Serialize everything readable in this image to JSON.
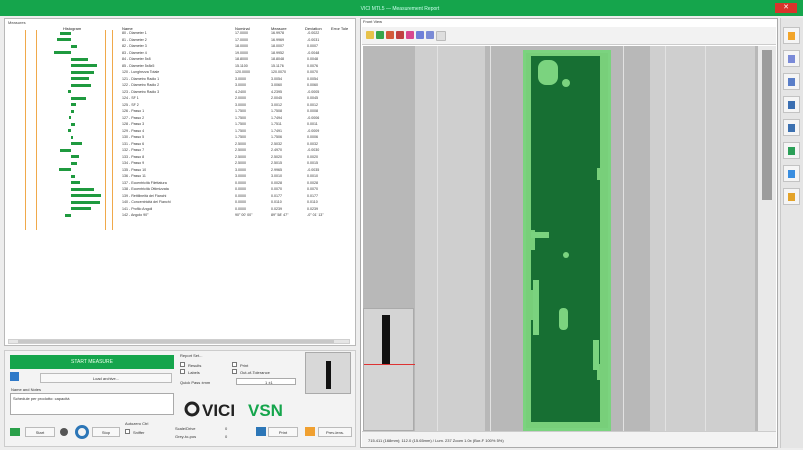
{
  "window": {
    "title": "VICI MTL5 — Measurement Report",
    "close_label": "✕"
  },
  "left_panel": {
    "title": "Measures",
    "headers": {
      "histogram": "Histogram",
      "name": "Name",
      "nominal": "Nominal",
      "measure": "Measure",
      "deviation": "Deviation",
      "error": "Error Tole"
    },
    "rows": [
      {
        "name": "80 - Diameter 1",
        "nom": "17.0000",
        "meas": "16.9978",
        "dev": "-0.0022"
      },
      {
        "name": "81 - Diameter 2",
        "nom": "17.0000",
        "meas": "16.9969",
        "dev": "-0.0031"
      },
      {
        "name": "82 - Diameter 3",
        "nom": "18.0000",
        "meas": "18.0007",
        "dev": "0.0007"
      },
      {
        "name": "83 - Diameter 4",
        "nom": "19.0000",
        "meas": "18.9952",
        "dev": "-0.0048"
      },
      {
        "name": "84 - Diameter 5x8",
        "nom": "18.8000",
        "meas": "18.8048",
        "dev": "0.0048"
      },
      {
        "name": "85 - Diameter 5x8x5",
        "nom": "15.1100",
        "meas": "15.1176",
        "dev": "0.0076"
      },
      {
        "name": "120 - Lunghezza Totale",
        "nom": "120.0000",
        "meas": "120.0070",
        "dev": "0.0070"
      },
      {
        "name": "121 - Diametro Radio 1",
        "nom": "3.0000",
        "meas": "3.0054",
        "dev": "0.0054"
      },
      {
        "name": "122 - Diametro Radio 2",
        "nom": "3.0000",
        "meas": "3.0060",
        "dev": "0.0060"
      },
      {
        "name": "123 - Diametro Radio 3",
        "nom": "4.2400",
        "meas": "4.2395",
        "dev": "-0.0005"
      },
      {
        "name": "124 - SF 1",
        "nom": "2.0000",
        "meas": "2.0045",
        "dev": "0.0045"
      },
      {
        "name": "125 - SF 2",
        "nom": "3.0000",
        "meas": "3.0012",
        "dev": "0.0012"
      },
      {
        "name": "126 - Passo 1",
        "nom": "1.7500",
        "meas": "1.7508",
        "dev": "0.0008"
      },
      {
        "name": "127 - Passo 2",
        "nom": "1.7500",
        "meas": "1.7494",
        "dev": "-0.0006"
      },
      {
        "name": "128 - Passo 3",
        "nom": "1.7500",
        "meas": "1.7511",
        "dev": "0.0011"
      },
      {
        "name": "129 - Passo 4",
        "nom": "1.7500",
        "meas": "1.7491",
        "dev": "-0.0009"
      },
      {
        "name": "130 - Passo 5",
        "nom": "1.7500",
        "meas": "1.7506",
        "dev": "0.0006"
      },
      {
        "name": "131 - Passo 6",
        "nom": "2.5000",
        "meas": "2.5032",
        "dev": "0.0032"
      },
      {
        "name": "132 - Passo 7",
        "nom": "2.5000",
        "meas": "2.4970",
        "dev": "-0.0030"
      },
      {
        "name": "133 - Passo 8",
        "nom": "2.5000",
        "meas": "2.5020",
        "dev": "0.0020"
      },
      {
        "name": "134 - Passo 9",
        "nom": "2.5000",
        "meas": "2.5015",
        "dev": "0.0015"
      },
      {
        "name": "135 - Passo 10",
        "nom": "3.0000",
        "meas": "2.9965",
        "dev": "-0.0035"
      },
      {
        "name": "136 - Passo 11",
        "nom": "3.0000",
        "meas": "3.0010",
        "dev": "0.0010"
      },
      {
        "name": "137 - Eccentricità Filettatura",
        "nom": "0.0000",
        "meas": "0.0028",
        "dev": "0.0028"
      },
      {
        "name": "138 - Eccentricità Ottimizzata",
        "nom": "0.0000",
        "meas": "0.0070",
        "dev": "0.0070"
      },
      {
        "name": "139 - Rettilineità dei Fianchi",
        "nom": "0.0000",
        "meas": "0.0177",
        "dev": "0.0177"
      },
      {
        "name": "140 - Concentricità dei Fianchi",
        "nom": "0.0000",
        "meas": "0.0110",
        "dev": "0.0110"
      },
      {
        "name": "141 - Profilo Angoli",
        "nom": "0.0000",
        "meas": "0.0239",
        "dev": "0.0239"
      },
      {
        "name": "142 - Angolo 90°",
        "nom": "90° 00' 00\"",
        "meas": "89° 58' 47\"",
        "dev": "-0° 01' 13\""
      }
    ],
    "bars": [
      0.35,
      0.45,
      0.2,
      0.55,
      0.55,
      0.85,
      0.75,
      0.6,
      0.65,
      0.1,
      0.5,
      0.15,
      0.1,
      0.08,
      0.12,
      0.1,
      0.08,
      0.35,
      0.35,
      0.25,
      0.2,
      0.4,
      0.12,
      0.3,
      0.75,
      1.0,
      0.95,
      0.65,
      0.2
    ],
    "bars_negative": [
      true,
      true,
      false,
      true,
      false,
      false,
      false,
      false,
      false,
      true,
      false,
      false,
      false,
      true,
      false,
      true,
      false,
      false,
      true,
      false,
      false,
      true,
      false,
      false,
      false,
      false,
      false,
      false,
      true
    ]
  },
  "controls": {
    "start_label": "START MEASURE",
    "load_label": "Load archive...",
    "name_label": "Name and Notes",
    "name_value": "Schedule per prodotto: capacità",
    "report_title": "Report Set...",
    "chk_results": "Results",
    "chk_labels": "Labels",
    "chk_print": "Print",
    "chk_out_tol": "Out-of-Tolerance",
    "tol_label": "Quick Pass ±mm",
    "tol_value": "1  ±1",
    "autozero": "Autozero Ctrl",
    "btn_start": "Start",
    "btn_stop": "Stop",
    "btn_zoom": "Zoom",
    "chk_sniffer": "Sniffer",
    "status_a": "Scale/Drive",
    "status_b": "Grey-to-pos",
    "val_a": "0",
    "val_b": "0",
    "btn_print": "Print",
    "btn_prev": "Prev-lens.",
    "logo": "VICI",
    "logo_suffix": "VSN"
  },
  "right_pane": {
    "title": "Front View",
    "status": "715.411 (168mm); 112.0 (15.65mm) / Lum. 237  Zoom 1.0x  (Bor-F 100% 5%)"
  }
}
